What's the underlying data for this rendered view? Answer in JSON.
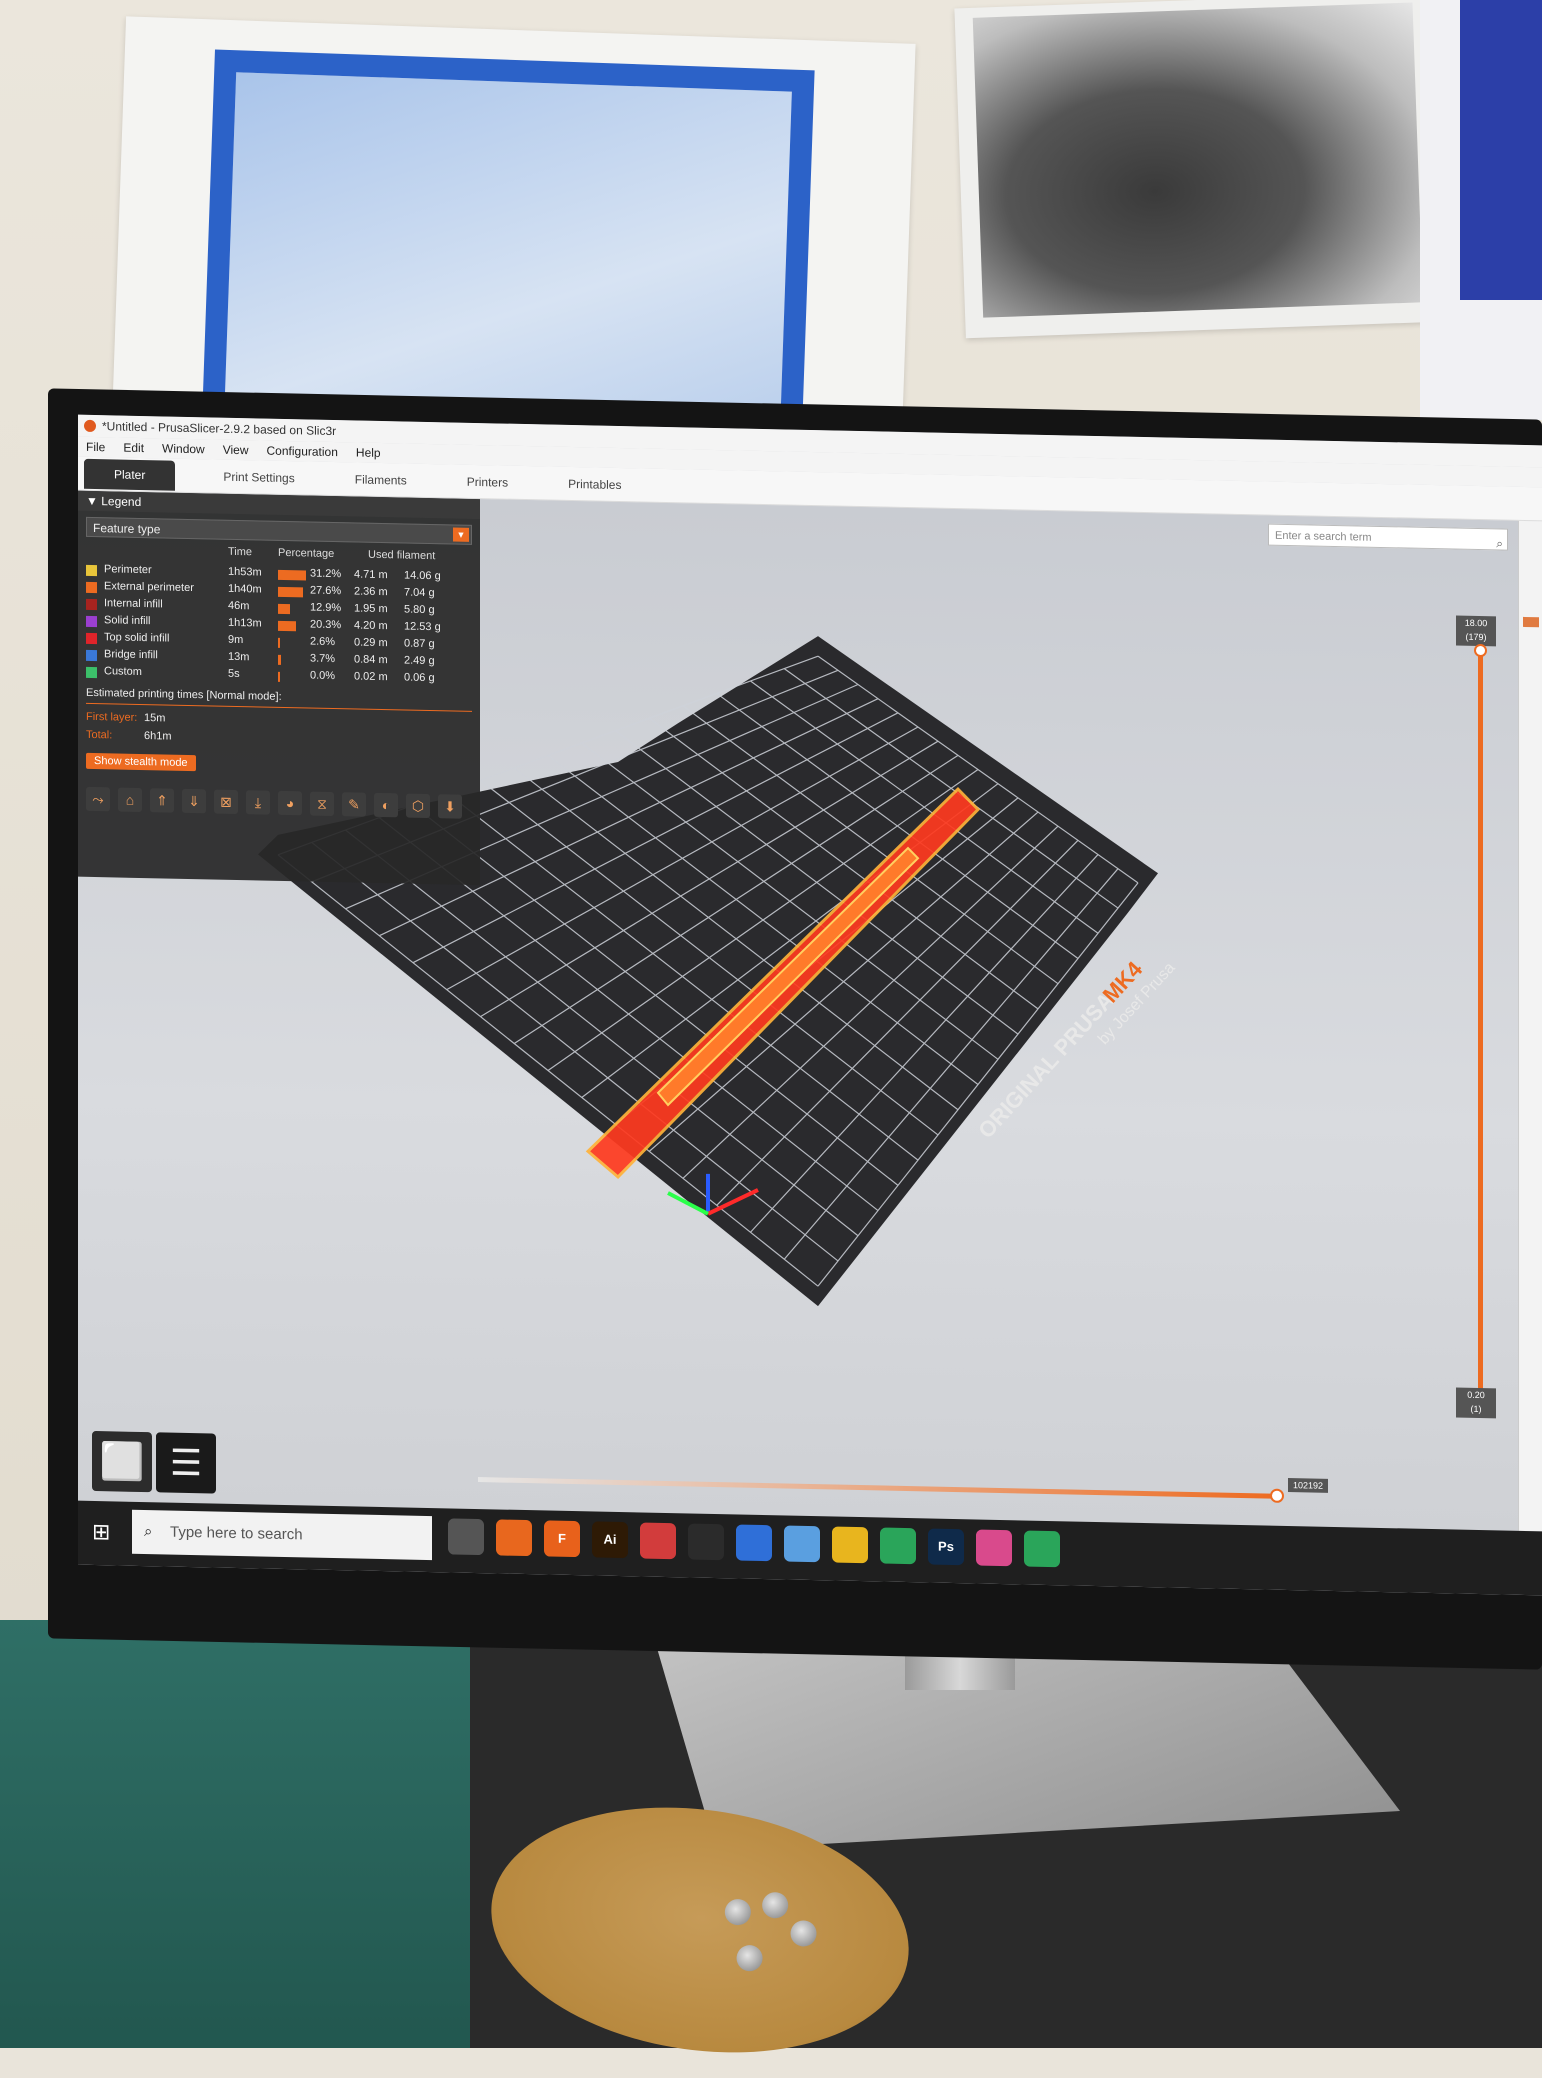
{
  "window": {
    "title": "*Untitled - PrusaSlicer-2.9.2 based on Slic3r"
  },
  "menu": [
    "File",
    "Edit",
    "Window",
    "View",
    "Configuration",
    "Help"
  ],
  "tabs": [
    "Plater",
    "Print Settings",
    "Filaments",
    "Printers",
    "Printables"
  ],
  "search": {
    "placeholder": "Enter a search term"
  },
  "legend": {
    "header": "Legend",
    "feature_select": "Feature type",
    "columns": {
      "time": "Time",
      "percentage": "Percentage",
      "used_filament": "Used filament"
    },
    "rows": [
      {
        "name": "Perimeter",
        "time": "1h53m",
        "percent": "31.2%",
        "length": "4.71 m",
        "weight": "14.06 g",
        "color": "#e8c53a",
        "pct": 31.2
      },
      {
        "name": "External perimeter",
        "time": "1h40m",
        "percent": "27.6%",
        "length": "2.36 m",
        "weight": "7.04 g",
        "color": "#ed6b21",
        "pct": 27.6
      },
      {
        "name": "Internal infill",
        "time": "46m",
        "percent": "12.9%",
        "length": "1.95 m",
        "weight": "5.80 g",
        "color": "#a8231f",
        "pct": 12.9
      },
      {
        "name": "Solid infill",
        "time": "1h13m",
        "percent": "20.3%",
        "length": "4.20 m",
        "weight": "12.53 g",
        "color": "#9b3fd0",
        "pct": 20.3
      },
      {
        "name": "Top solid infill",
        "time": "9m",
        "percent": "2.6%",
        "length": "0.29 m",
        "weight": "0.87 g",
        "color": "#e0242a",
        "pct": 2.6
      },
      {
        "name": "Bridge infill",
        "time": "13m",
        "percent": "3.7%",
        "length": "0.84 m",
        "weight": "2.49 g",
        "color": "#3a78d8",
        "pct": 3.7
      },
      {
        "name": "Custom",
        "time": "5s",
        "percent": "0.0%",
        "length": "0.02 m",
        "weight": "0.06 g",
        "color": "#3cc06a",
        "pct": 0.0
      }
    ],
    "estimate_title": "Estimated printing times [Normal mode]:",
    "first_layer_label": "First layer:",
    "first_layer_value": "15m",
    "total_label": "Total:",
    "total_value": "6h1m",
    "stealth_button": "Show stealth mode"
  },
  "bed": {
    "brand_line1": "ORIGINAL PRUSA",
    "brand_model": "MK4",
    "brand_line2": "by Josef Prusa"
  },
  "sliders": {
    "vertical_top_line1": "18.00",
    "vertical_top_line2": "(179)",
    "vertical_bottom_line1": "0.20",
    "vertical_bottom_line2": "(1)",
    "horizontal_label": "102192"
  },
  "taskbar": {
    "search_placeholder": "Type here to search",
    "apps": [
      {
        "label": "",
        "color": "#555"
      },
      {
        "label": "",
        "color": "#e8671e"
      },
      {
        "label": "F",
        "color": "#e8611b"
      },
      {
        "label": "Ai",
        "color": "#2e1a05"
      },
      {
        "label": "",
        "color": "#d23c3c"
      },
      {
        "label": "",
        "color": "#2b2b2b"
      },
      {
        "label": "",
        "color": "#2f6fd8"
      },
      {
        "label": "",
        "color": "#5a9fe0"
      },
      {
        "label": "",
        "color": "#e8b51e"
      },
      {
        "label": "",
        "color": "#2aa55a"
      },
      {
        "label": "Ps",
        "color": "#0f2a4a"
      },
      {
        "label": "",
        "color": "#d94a8c"
      },
      {
        "label": "",
        "color": "#2aa55a"
      }
    ]
  },
  "colors": {
    "accent": "#ed6b21",
    "legend_bg": "#282828",
    "bed": "#2a2a2d"
  }
}
